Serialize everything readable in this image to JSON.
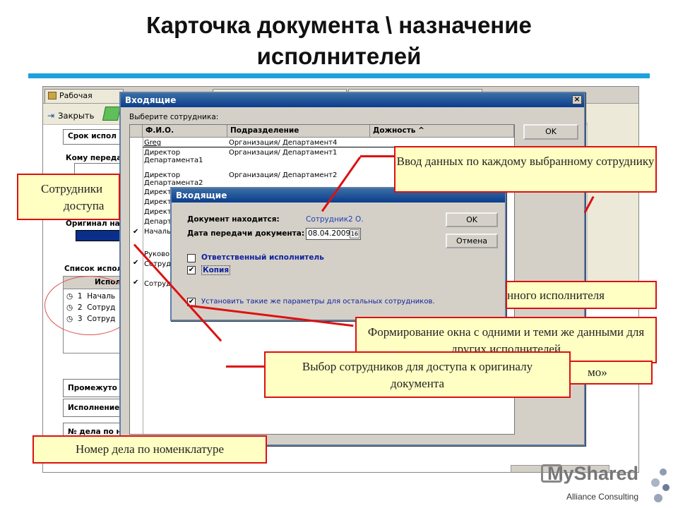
{
  "slide": {
    "title_line1": "Карточка документа \\ назначение",
    "title_line2": "исполнителей"
  },
  "app": {
    "tab1": "Рабочая область",
    "close_label": "Закрыть",
    "field_deadline": "Срок испол",
    "field_to": "Кому переда",
    "field_original": "Оригинал на",
    "list_label": "Список испол",
    "list_header": "Испол",
    "rows": [
      {
        "num": "1",
        "name": "Началь"
      },
      {
        "num": "2",
        "name": "Сотруд"
      },
      {
        "num": "3",
        "name": "Сотруд"
      }
    ],
    "field_interim": "Промежуто",
    "field_exec": "Исполнение",
    "field_case": "№ дела по н"
  },
  "dialog_outer": {
    "title": "Входящие",
    "prompt": "Выберите сотрудника:",
    "ok": "OK",
    "columns": [
      "Ф.И.О.",
      "Подразделение",
      "Дожность ^"
    ],
    "rows": [
      {
        "name": "Greg",
        "dept": "Организация/ Департамент4",
        "check": ""
      },
      {
        "name": "Директор Департамента1",
        "dept": "Организация/ Департамент1",
        "check": ""
      },
      {
        "name": "Директор Департамента2",
        "dept": "Организация/ Департамент2",
        "check": ""
      },
      {
        "name": "Директ",
        "dept": "",
        "check": ""
      },
      {
        "name": "Директ",
        "dept": "",
        "check": ""
      },
      {
        "name": "Директ",
        "dept": "",
        "check": ""
      },
      {
        "name": "Департ",
        "dept": "",
        "check": ""
      },
      {
        "name": "Началь",
        "dept": "",
        "check": "✔"
      },
      {
        "name": "Руково",
        "dept": "",
        "check": ""
      },
      {
        "name": "Сотруд",
        "dept": "",
        "check": "✔"
      },
      {
        "name": "Сотруд",
        "dept": "",
        "check": "✔"
      }
    ]
  },
  "dialog_inner": {
    "title": "Входящие",
    "doc_location_label": "Документ находится:",
    "doc_location_value": "Сотрудник2 О.",
    "date_label": "Дата передачи документа:",
    "date_value": "08.04.2009",
    "date_btn": "16",
    "ok": "OK",
    "cancel": "Отмена",
    "opt_responsible": "Ответственный исполнитель",
    "opt_copy": "Копия",
    "opt_same": "Установить такие же параметры для остальных сотрудников."
  },
  "callouts": {
    "c1": "Ввод данных по каждому выбранному сотруднику",
    "c2_line1": "Сотрудники",
    "c2_line2": "доступа",
    "c3": "нного исполнителя",
    "c4": "Формирование окна с одними и теми же данными для других исполнителей",
    "c5": "Выбор сотрудников для доступа к оригиналу документа",
    "c6": "мо»",
    "c7": "Номер дела по номенклатуре"
  },
  "brand": {
    "name": "MyShared",
    "sub": "Alliance Consulting"
  },
  "colors": {
    "accent_rule": "#1ea1de",
    "callout_bg": "#ffffc4",
    "callout_border": "#dd1111",
    "titlebar": "#0b3d8c"
  }
}
